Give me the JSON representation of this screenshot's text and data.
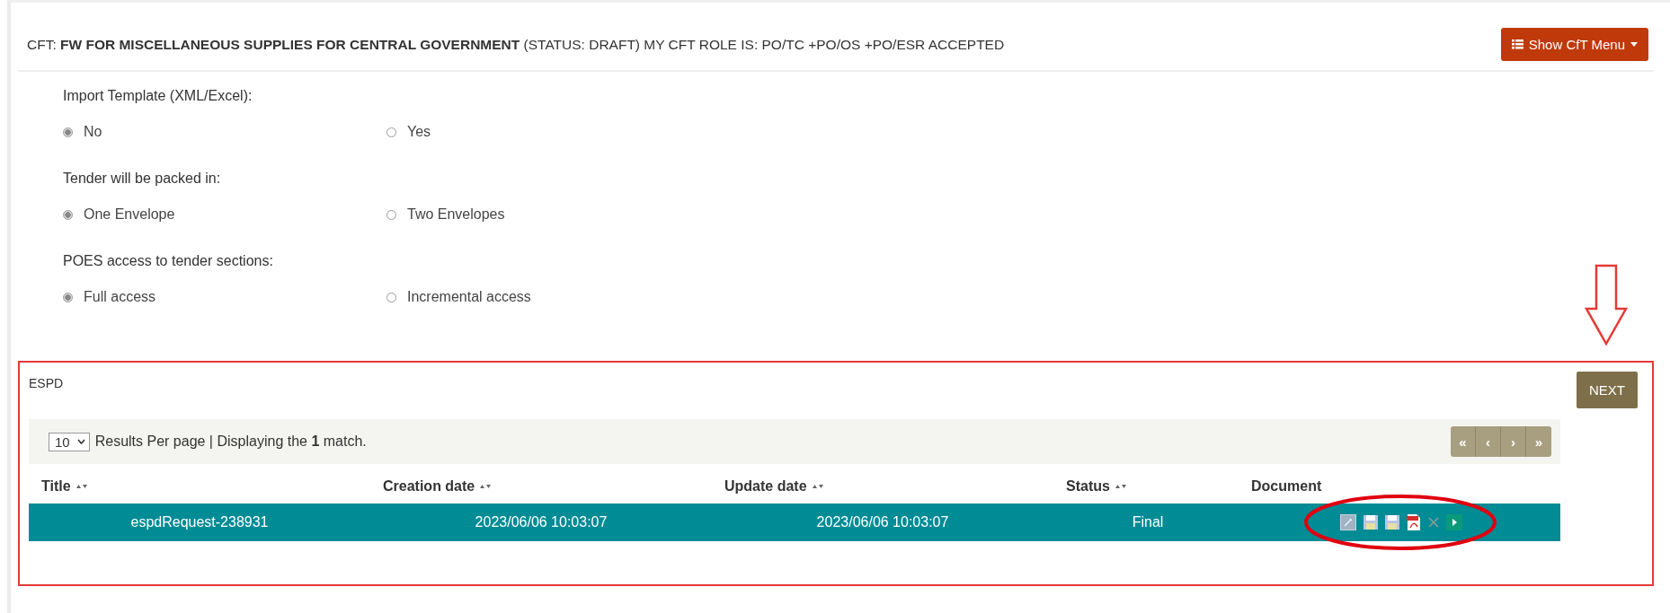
{
  "header": {
    "title": "CFT: **FW FOR MISCELLANEOUS SUPPLIES FOR CENTRAL GOVERNMENT** (STATUS: DRAFT) MY CFT ROLE IS: PO/TC +PO/OS +PO/ESR ACCEPTED",
    "menu_button": "Show CfT Menu"
  },
  "radio_groups": [
    {
      "label": "Import Template (XML/Excel):",
      "options": [
        {
          "label": "No",
          "selected": true
        },
        {
          "label": "Yes",
          "selected": false
        }
      ]
    },
    {
      "label": "Tender will be packed in:",
      "options": [
        {
          "label": "One Envelope",
          "selected": true
        },
        {
          "label": "Two Envelopes",
          "selected": false
        }
      ]
    },
    {
      "label": "POES access to tender sections:",
      "options": [
        {
          "label": "Full access",
          "selected": true
        },
        {
          "label": "Incremental access",
          "selected": false
        }
      ]
    }
  ],
  "espd": {
    "title": "ESPD",
    "next_button": "NEXT",
    "per_page": "10",
    "summary": "Results Per page | Displaying the **1** match.",
    "pager": [
      "«",
      "‹",
      "›",
      "»"
    ],
    "columns": [
      {
        "label": "Title",
        "sortable": true
      },
      {
        "label": "Creation date",
        "sortable": true
      },
      {
        "label": "Update date",
        "sortable": true
      },
      {
        "label": "Status",
        "sortable": true
      },
      {
        "label": "Document",
        "sortable": false
      }
    ],
    "rows": [
      {
        "selected": true,
        "cells": [
          "espdRequest-238931",
          "2023/06/06 10:03:07",
          "2023/06/06 10:03:07",
          "Final"
        ]
      }
    ]
  }
}
